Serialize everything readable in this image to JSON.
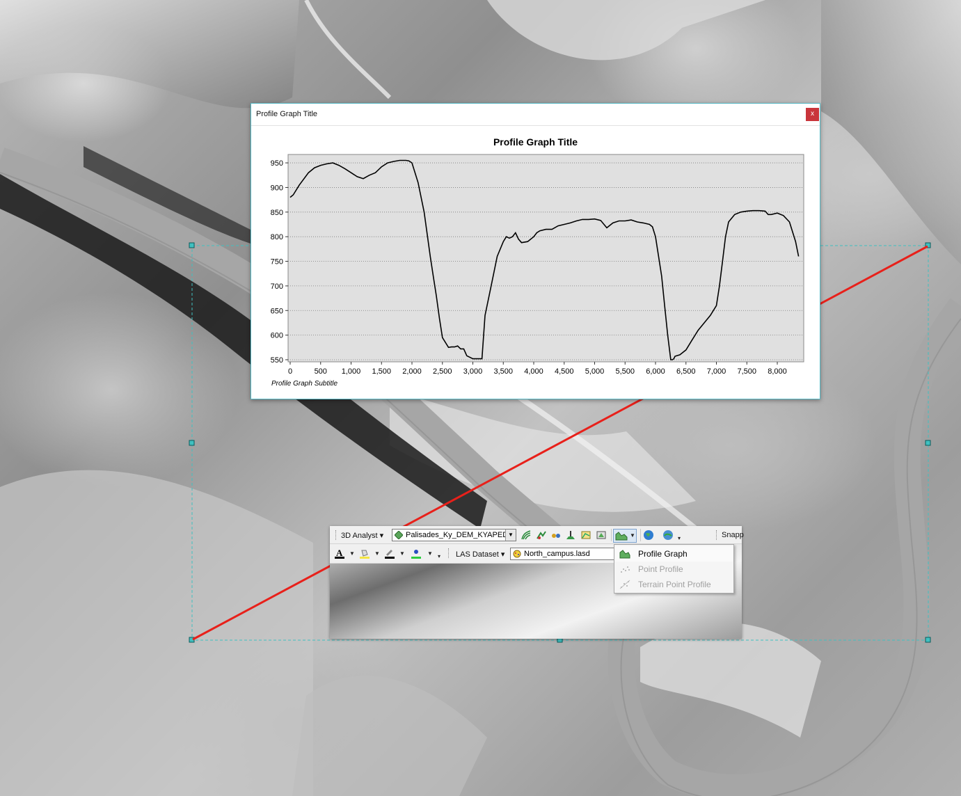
{
  "map": {
    "river_color": "#a6a6a6",
    "profile_line_color": "#e8201a",
    "selection_color": "#40c0c0"
  },
  "profile_window": {
    "window_title": "Profile Graph Title",
    "close_label": "x",
    "graph_title": "Profile Graph Title",
    "graph_subtitle": "Profile Graph Subtitle"
  },
  "chart_data": {
    "type": "line",
    "title": "Profile Graph Title",
    "subtitle": "Profile Graph Subtitle",
    "xlabel": "",
    "ylabel": "",
    "xlim": [
      0,
      8400
    ],
    "ylim": [
      550,
      960
    ],
    "grid": true,
    "x_ticks": [
      "0",
      "500",
      "1,000",
      "1,500",
      "2,000",
      "2,500",
      "3,000",
      "3,500",
      "4,000",
      "4,500",
      "5,000",
      "5,500",
      "6,000",
      "6,500",
      "7,000",
      "7,500",
      "8,000"
    ],
    "y_ticks": [
      "950",
      "900",
      "850",
      "800",
      "750",
      "700",
      "650",
      "600",
      "550"
    ],
    "series": [
      {
        "x": [
          0,
          50,
          150,
          300,
          400,
          500,
          600,
          700,
          800,
          900,
          1000,
          1100,
          1200,
          1300,
          1400,
          1500,
          1600,
          1700,
          1800,
          1900,
          1950,
          2000,
          2100,
          2200,
          2300,
          2350,
          2400,
          2450,
          2500,
          2600,
          2650,
          2700,
          2750,
          2800,
          2850,
          2900,
          3000,
          3050,
          3100,
          3150,
          3200,
          3300,
          3400,
          3500,
          3550,
          3600,
          3650,
          3700,
          3750,
          3800,
          3900,
          4000,
          4050,
          4100,
          4200,
          4300,
          4400,
          4500,
          4600,
          4700,
          4800,
          4900,
          5000,
          5100,
          5200,
          5300,
          5400,
          5500,
          5600,
          5700,
          5800,
          5900,
          5950,
          6000,
          6050,
          6100,
          6150,
          6200,
          6250,
          6280,
          6300,
          6320,
          6400,
          6500,
          6600,
          6700,
          6800,
          6900,
          7000,
          7050,
          7100,
          7150,
          7200,
          7300,
          7400,
          7500,
          7600,
          7700,
          7800,
          7850,
          7900,
          8000,
          8100,
          8200,
          8300,
          8350
        ],
        "y": [
          880,
          885,
          905,
          930,
          940,
          945,
          948,
          950,
          945,
          938,
          930,
          922,
          918,
          925,
          930,
          942,
          950,
          953,
          955,
          955,
          954,
          950,
          910,
          850,
          760,
          720,
          680,
          635,
          595,
          575,
          576,
          576,
          578,
          572,
          572,
          558,
          552,
          552,
          552,
          552,
          640,
          700,
          760,
          790,
          800,
          797,
          800,
          808,
          795,
          788,
          790,
          800,
          808,
          812,
          815,
          815,
          822,
          825,
          828,
          832,
          835,
          835,
          836,
          833,
          818,
          828,
          832,
          832,
          834,
          830,
          828,
          825,
          820,
          800,
          760,
          720,
          660,
          600,
          550,
          550,
          552,
          557,
          560,
          570,
          590,
          610,
          625,
          640,
          660,
          700,
          750,
          800,
          830,
          845,
          850,
          852,
          853,
          853,
          852,
          845,
          845,
          848,
          843,
          830,
          790,
          760
        ]
      }
    ]
  },
  "toolbar": {
    "analyst_menu": "3D Analyst",
    "layer_combo": "Palisades_Ky_DEM_KYAPED",
    "las_menu": "LAS Dataset",
    "las_combo": "North_campus.lasd",
    "snapping_label": "Snapp",
    "font_color": "#000000",
    "fill_color": "#f5e642",
    "line_color": "#000000",
    "marker_color": "#2ecc40"
  },
  "profile_menu": {
    "items": [
      {
        "label": "Profile Graph",
        "enabled": true
      },
      {
        "label": "Point Profile",
        "enabled": false
      },
      {
        "label": "Terrain Point Profile",
        "enabled": false
      }
    ]
  }
}
